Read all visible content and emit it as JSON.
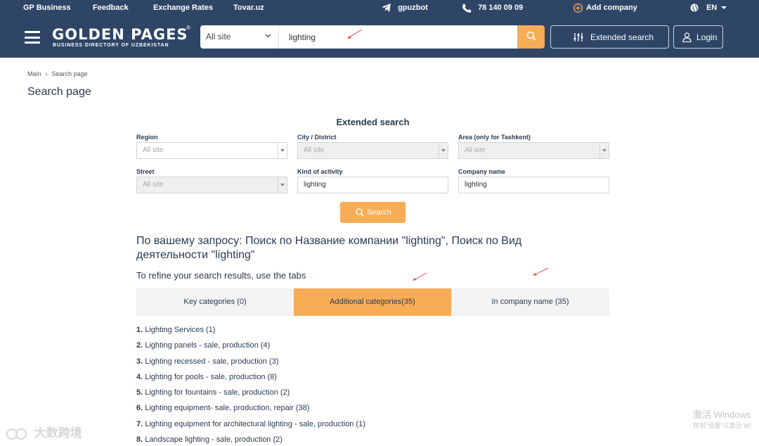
{
  "topbar": {
    "links": [
      "GP Business",
      "Feedback",
      "Exchange Rates",
      "Tovar.uz"
    ],
    "telegram": "gpuzbot",
    "phone": "78 140 09 09",
    "add_company": "Add company",
    "language": "EN"
  },
  "header": {
    "logo_title": "GOLDEN PAGES",
    "logo_reg": "®",
    "logo_subtitle": "BUSINESS DIRECTORY OF UZBEKISTAN",
    "site_select": "All site",
    "search_value": "lighting",
    "extended_search": "Extended search",
    "login": "Login"
  },
  "breadcrumb": [
    "Main",
    "Search page"
  ],
  "page_title": "Search page",
  "extended": {
    "title": "Extended search",
    "region_label": "Region",
    "region_value": "All site",
    "city_label": "City / District",
    "city_value": "All site",
    "area_label": "Area (only for Tashkent)",
    "area_value": "All site",
    "street_label": "Street",
    "street_value": "All site",
    "activity_label": "Kind of activity",
    "activity_value": "lighting",
    "company_label": "Company name",
    "company_value": "lighting",
    "search_button": "Search"
  },
  "query_text": "По вашему запросу: Поиск по Название компании \"lighting\", Поиск по Вид деятельности \"lighting\"",
  "refine_text": "To refine your search results, use the tabs",
  "tabs": [
    {
      "label": "Key categories (0)",
      "active": false
    },
    {
      "label": "Additional categories(35)",
      "active": true
    },
    {
      "label": "In company name (35)",
      "active": false
    }
  ],
  "results": [
    {
      "num": "1.",
      "name": "Lighting Services",
      "count": "(1)"
    },
    {
      "num": "2.",
      "name": "Lighting panels - sale, production",
      "count": "(4)"
    },
    {
      "num": "3.",
      "name": "Lighting recessed - sale, production",
      "count": "(3)"
    },
    {
      "num": "4.",
      "name": "Lighting for pools - sale, production",
      "count": "(8)"
    },
    {
      "num": "5.",
      "name": "Lighting for fountains - sale, production",
      "count": "(2)"
    },
    {
      "num": "6.",
      "name": "Lighting equipment- sale, production, repair",
      "count": "(38)"
    },
    {
      "num": "7.",
      "name": "Lighting equipment for architectural lighting - sale, production",
      "count": "(1)"
    },
    {
      "num": "8.",
      "name": "Landscape lighting - sale, production",
      "count": "(2)"
    }
  ],
  "watermark": {
    "line1": "激活 Windows",
    "line2": "转到\"设置\"以激活 Wi",
    "corner": "大数跨境"
  },
  "colors": {
    "header": "#2e4566",
    "accent": "#f7ac56"
  }
}
